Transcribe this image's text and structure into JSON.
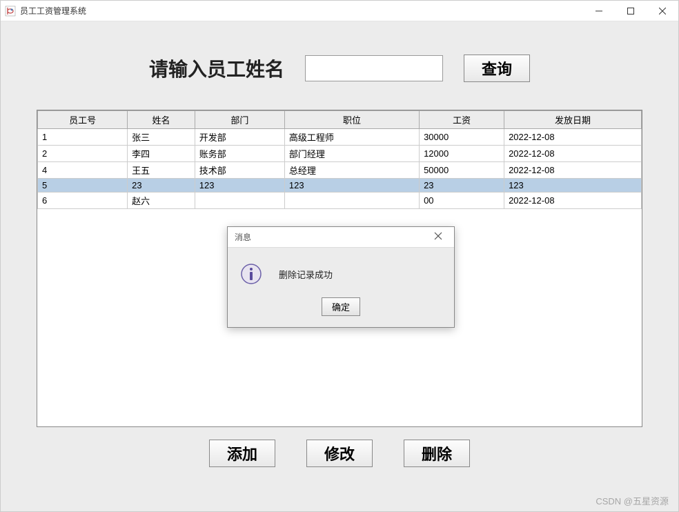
{
  "window": {
    "title": "员工工资管理系统"
  },
  "search": {
    "label": "请输入员工姓名",
    "input_value": "",
    "button": "查询"
  },
  "table": {
    "headers": [
      "员工号",
      "姓名",
      "部门",
      "职位",
      "工资",
      "发放日期"
    ],
    "rows": [
      {
        "cells": [
          "1",
          "张三",
          "开发部",
          "高级工程师",
          "30000",
          "2022-12-08"
        ],
        "selected": false
      },
      {
        "cells": [
          "2",
          "李四",
          "账务部",
          "部门经理",
          "12000",
          "2022-12-08"
        ],
        "selected": false
      },
      {
        "cells": [
          "4",
          "王五",
          "技术部",
          "总经理",
          "50000",
          "2022-12-08"
        ],
        "selected": false
      },
      {
        "cells": [
          "5",
          "23",
          "123",
          "123",
          "23",
          "123"
        ],
        "selected": true
      },
      {
        "cells": [
          "6",
          "赵六",
          "",
          "",
          "00",
          "2022-12-08"
        ],
        "selected": false
      }
    ]
  },
  "actions": {
    "add": "添加",
    "edit": "修改",
    "delete": "删除"
  },
  "dialog": {
    "title": "消息",
    "message": "删除记录成功",
    "ok": "确定"
  },
  "watermark": "CSDN @五星资源"
}
